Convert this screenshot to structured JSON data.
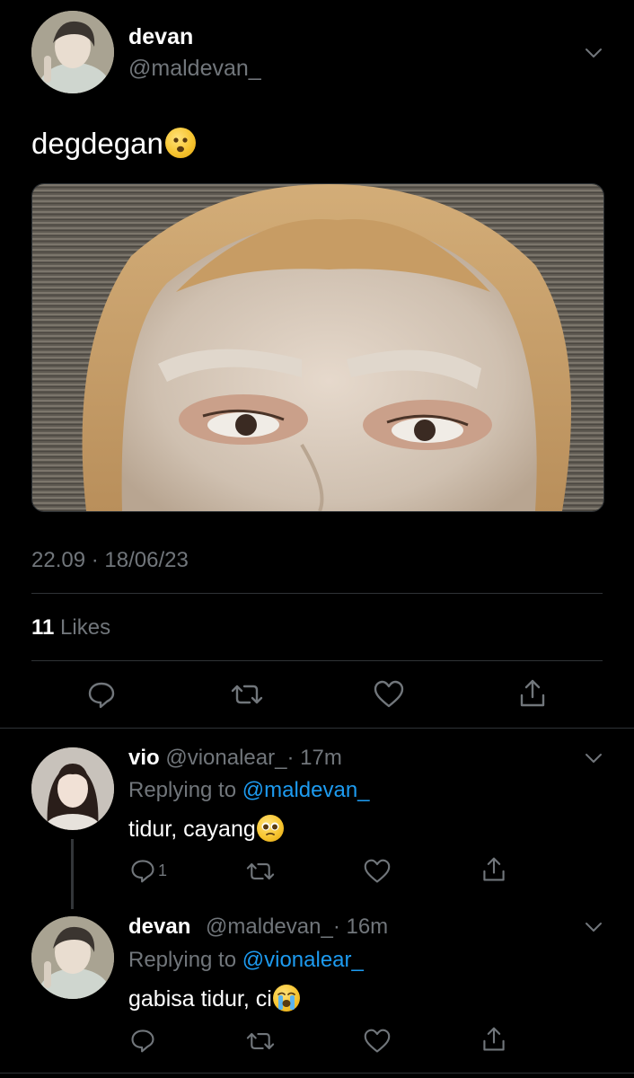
{
  "tweet": {
    "display_name": "devan",
    "handle": "@maldevan_",
    "text": "degdegan",
    "timestamp": "22.09 · 18/06/23",
    "likes_count": "11",
    "likes_label": "Likes"
  },
  "replies": [
    {
      "display_name": "vio",
      "handle": "@vionalear_",
      "time": "· 17m",
      "replying_prefix": "Replying to",
      "replying_to": "@maldevan_",
      "text": "tidur, cayang",
      "reply_count": "1"
    },
    {
      "display_name": "devan",
      "handle": "@maldevan_",
      "time": "· 16m",
      "replying_prefix": "Replying to",
      "replying_to": "@vionalear_",
      "text": "gabisa tidur, ci"
    }
  ],
  "icons": {
    "more": "chevron-down-icon",
    "reply": "reply-icon",
    "retweet": "retweet-icon",
    "like": "heart-icon",
    "share": "share-icon"
  },
  "colors": {
    "background": "#000000",
    "text": "#ffffff",
    "muted": "#71767b",
    "link": "#1d9bf0",
    "divider": "#2f3336"
  }
}
